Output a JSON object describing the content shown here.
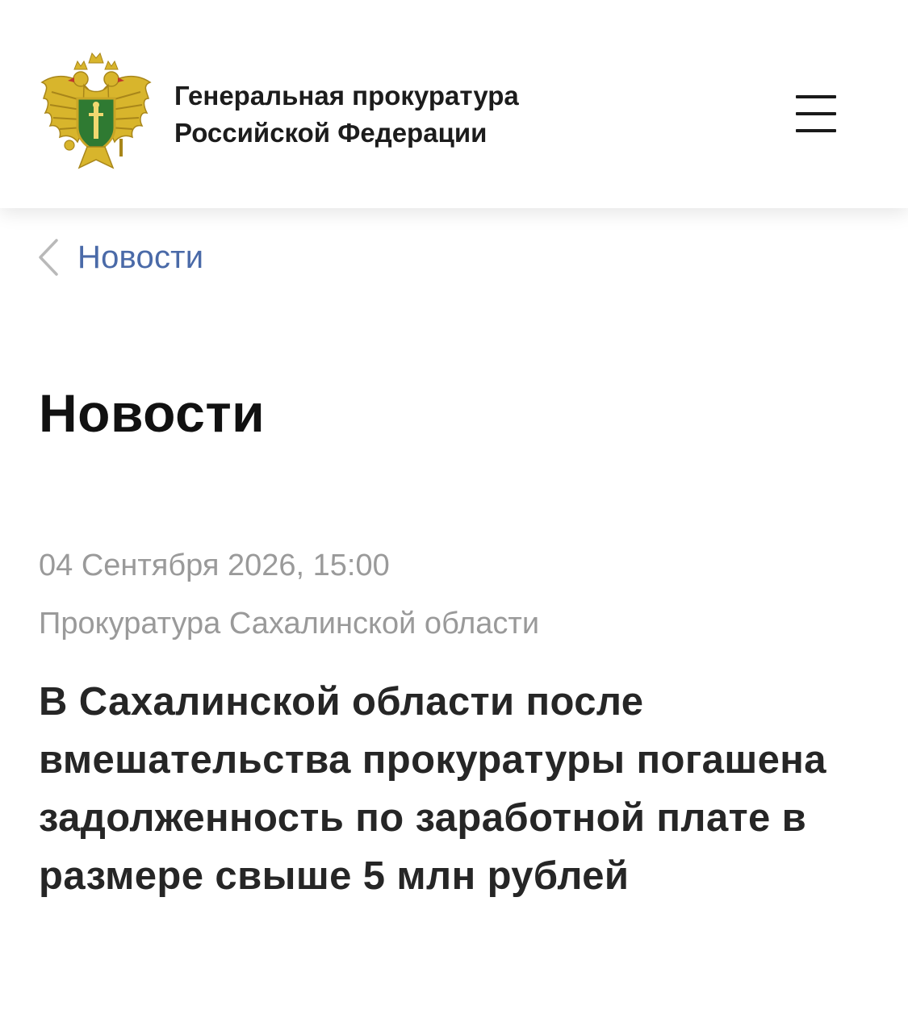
{
  "header": {
    "emblem_icon": "double-headed-eagle-emblem",
    "org_name_line1": "Генеральная прокуратура",
    "org_name_line2": "Российской Федерации",
    "menu_icon": "hamburger-menu-icon"
  },
  "breadcrumb": {
    "back_icon": "chevron-left-icon",
    "label": "Новости"
  },
  "page": {
    "title": "Новости"
  },
  "news_item": {
    "date": "04 Сентября 2026, 15:00",
    "source": "Прокуратура Сахалинской области",
    "headline": "В Сахалинской области после вмешательства прокуратуры погашена задолженность по заработной плате в размере свыше 5 млн рублей"
  },
  "colors": {
    "link": "#4a6aa8",
    "meta_text": "#9a9a9a",
    "emblem_gold": "#d4b02a",
    "shield_green": "#2f7a32"
  }
}
